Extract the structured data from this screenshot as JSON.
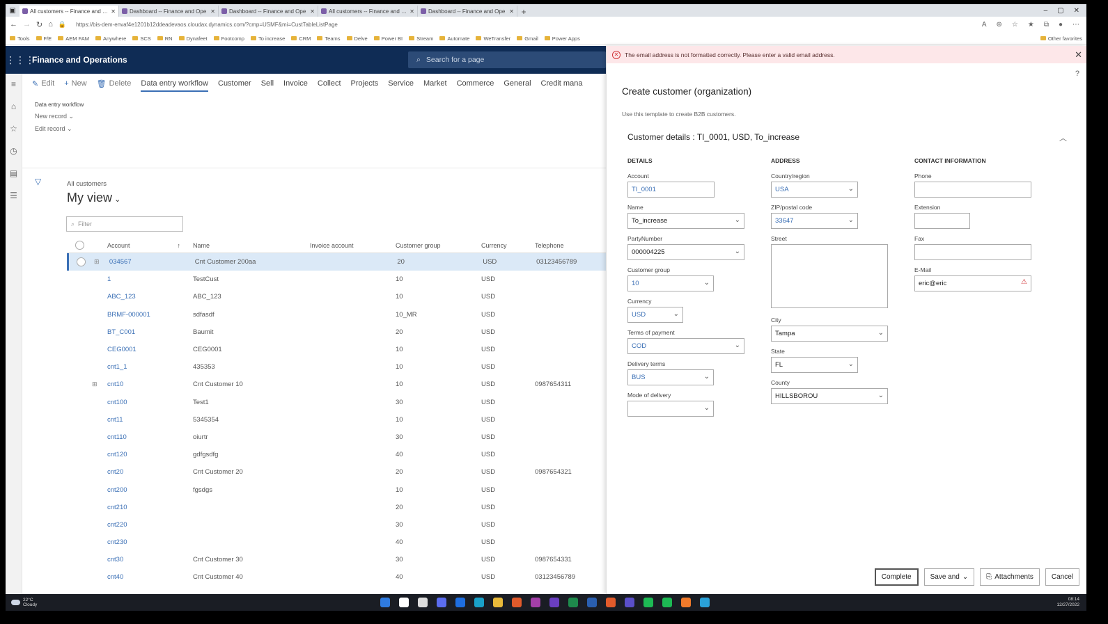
{
  "browser": {
    "tabs": [
      {
        "label": "All customers -- Finance and Op",
        "active": true
      },
      {
        "label": "Dashboard -- Finance and Ope",
        "active": false
      },
      {
        "label": "Dashboard -- Finance and Ope",
        "active": false
      },
      {
        "label": "All customers -- Finance and Op",
        "active": false
      },
      {
        "label": "Dashboard -- Finance and Ope",
        "active": false
      }
    ],
    "url": "https://bis-dem-envaf4e1201b12ddeadevaos.cloudax.dynamics.com/?cmp=USMF&mi=CustTableListPage",
    "bookmarks": [
      "Tools",
      "F/E",
      "AEM FAM",
      "Anywhere",
      "SCS",
      "RN",
      "Dynafeet",
      "Footcomp",
      "To increase",
      "CRM",
      "Teams",
      "Delve",
      "Power BI",
      "Stream",
      "Automate",
      "WeTransfer",
      "Gmail",
      "Power Apps"
    ],
    "other_favorites": "Other favorites"
  },
  "app": {
    "title": "Finance and Operations",
    "search_placeholder": "Search for a page"
  },
  "action_pane": {
    "edit": "Edit",
    "new": "New",
    "delete": "Delete",
    "tabs": [
      "Data entry workflow",
      "Customer",
      "Sell",
      "Invoice",
      "Collect",
      "Projects",
      "Service",
      "Market",
      "Commerce",
      "General",
      "Credit mana"
    ]
  },
  "workflow": {
    "title": "Data entry workflow",
    "new_record": "New record",
    "edit_record": "Edit record"
  },
  "list": {
    "breadcrumb": "All customers",
    "view": "My view",
    "filter_placeholder": "Filter",
    "columns": [
      "Account",
      "Name",
      "Invoice account",
      "Customer group",
      "Currency",
      "Telephone"
    ],
    "rows": [
      {
        "account": "034567",
        "name": "Cnt Customer 200aa",
        "group": "20",
        "currency": "USD",
        "phone": "03123456789",
        "selected": true
      },
      {
        "account": "1",
        "name": "TestCust",
        "group": "10",
        "currency": "USD",
        "phone": ""
      },
      {
        "account": "ABC_123",
        "name": "ABC_123",
        "group": "10",
        "currency": "USD",
        "phone": ""
      },
      {
        "account": "BRMF-000001",
        "name": "sdfasdf",
        "group": "10_MR",
        "currency": "USD",
        "phone": ""
      },
      {
        "account": "BT_C001",
        "name": "Baumit",
        "group": "20",
        "currency": "USD",
        "phone": ""
      },
      {
        "account": "CEG0001",
        "name": "CEG0001",
        "group": "10",
        "currency": "USD",
        "phone": ""
      },
      {
        "account": "cnt1_1",
        "name": "435353",
        "group": "10",
        "currency": "USD",
        "phone": ""
      },
      {
        "account": "cnt10",
        "name": "Cnt Customer 10",
        "group": "10",
        "currency": "USD",
        "phone": "0987654311"
      },
      {
        "account": "cnt100",
        "name": "Test1",
        "group": "30",
        "currency": "USD",
        "phone": ""
      },
      {
        "account": "cnt11",
        "name": "5345354",
        "group": "10",
        "currency": "USD",
        "phone": ""
      },
      {
        "account": "cnt110",
        "name": "oiurtr",
        "group": "30",
        "currency": "USD",
        "phone": ""
      },
      {
        "account": "cnt120",
        "name": "gdfgsdfg",
        "group": "40",
        "currency": "USD",
        "phone": ""
      },
      {
        "account": "cnt20",
        "name": "Cnt Customer 20",
        "group": "20",
        "currency": "USD",
        "phone": "0987654321"
      },
      {
        "account": "cnt200",
        "name": "fgsdgs",
        "group": "10",
        "currency": "USD",
        "phone": ""
      },
      {
        "account": "cnt210",
        "name": "",
        "group": "20",
        "currency": "USD",
        "phone": ""
      },
      {
        "account": "cnt220",
        "name": "",
        "group": "30",
        "currency": "USD",
        "phone": ""
      },
      {
        "account": "cnt230",
        "name": "",
        "group": "40",
        "currency": "USD",
        "phone": ""
      },
      {
        "account": "cnt30",
        "name": "Cnt Customer 30",
        "group": "30",
        "currency": "USD",
        "phone": "0987654331"
      },
      {
        "account": "cnt40",
        "name": "Cnt Customer 40",
        "group": "40",
        "currency": "USD",
        "phone": "03123456789"
      }
    ]
  },
  "panel": {
    "error": "The email address is not formatted correctly. Please enter a valid email address.",
    "title": "Create customer (organization)",
    "subtitle": "Use this template to create B2B customers.",
    "section": "Customer details : TI_0001, USD, To_increase",
    "details": {
      "heading": "DETAILS",
      "account_label": "Account",
      "account": "TI_0001",
      "name_label": "Name",
      "name": "To_increase",
      "party_label": "PartyNumber",
      "party": "000004225",
      "group_label": "Customer group",
      "group": "10",
      "currency_label": "Currency",
      "currency": "USD",
      "terms_label": "Terms of payment",
      "terms": "COD",
      "delivery_label": "Delivery terms",
      "delivery": "BUS",
      "mode_label": "Mode of delivery",
      "mode": ""
    },
    "address": {
      "heading": "ADDRESS",
      "country_label": "Country/region",
      "country": "USA",
      "zip_label": "ZIP/postal code",
      "zip": "33647",
      "street_label": "Street",
      "street": "",
      "city_label": "City",
      "city": "Tampa",
      "state_label": "State",
      "state": "FL",
      "county_label": "County",
      "county": "HILLSBOROU"
    },
    "contact": {
      "heading": "CONTACT INFORMATION",
      "phone_label": "Phone",
      "phone": "",
      "ext_label": "Extension",
      "ext": "",
      "fax_label": "Fax",
      "fax": "",
      "email_label": "E-Mail",
      "email": "eric@eric"
    },
    "buttons": {
      "complete": "Complete",
      "save": "Save and",
      "attachments": "Attachments",
      "cancel": "Cancel"
    }
  },
  "taskbar": {
    "temp": "22°C",
    "weather": "Cloudy",
    "time": "08:14",
    "date": "12/27/2022",
    "icon_colors": [
      "#2f7be0",
      "#ffffff",
      "#dddddd",
      "#5b6df0",
      "#1e6ee0",
      "#1aa1c9",
      "#e8b93a",
      "#e05a2b",
      "#a33fa8",
      "#6a3fc1",
      "#1e8a4c",
      "#2a5fb0",
      "#e25b2b",
      "#5a4fc9",
      "#1db954",
      "#1db954",
      "#f07a2b",
      "#2aa1d8"
    ]
  }
}
